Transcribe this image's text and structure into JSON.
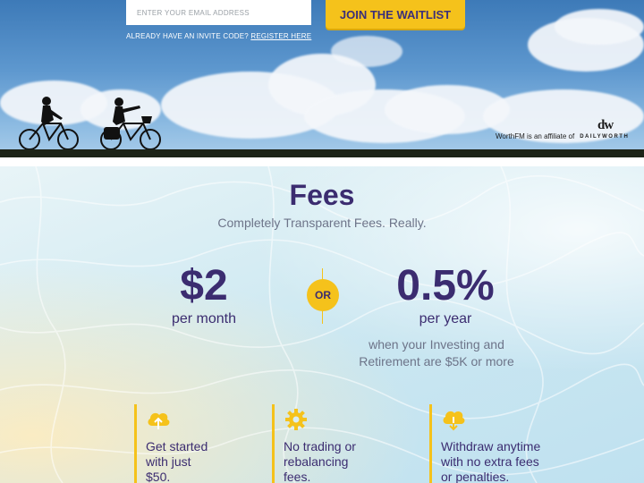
{
  "hero": {
    "email_placeholder": "ENTER YOUR EMAIL ADDRESS",
    "waitlist_button": "JOIN THE WAITLIST",
    "invite_prefix": "ALREADY HAVE AN INVITE CODE?",
    "invite_link": "REGISTER HERE",
    "affiliate_text": "WorthFM is an affiliate of",
    "affiliate_brand": "DAILYWORTH",
    "affiliate_logo": "dw"
  },
  "fees": {
    "title": "Fees",
    "subtitle": "Completely Transparent Fees. Really.",
    "left_amount": "$2",
    "left_period": "per month",
    "or_label": "OR",
    "right_amount": "0.5%",
    "right_period": "per year",
    "note_line1": "when your Investing and",
    "note_line2": "Retirement are $5K or more",
    "features": [
      {
        "icon": "cloud-upload-icon",
        "lines": [
          "Get started",
          "with just",
          "$50."
        ]
      },
      {
        "icon": "gear-icon",
        "lines": [
          "No trading or",
          "rebalancing",
          "fees."
        ]
      },
      {
        "icon": "cloud-download-icon",
        "lines": [
          "Withdraw anytime",
          "with no extra fees",
          "or penalties."
        ]
      }
    ]
  },
  "colors": {
    "accent": "#f5c21b",
    "primary_text": "#3b2c70",
    "muted_text": "#6d7489"
  }
}
